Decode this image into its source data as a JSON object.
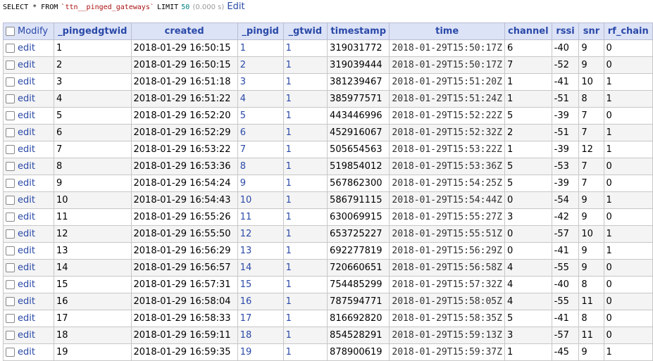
{
  "query": {
    "select": "SELECT * FROM",
    "table": "`ttn__pinged_gateways`",
    "limit": "LIMIT",
    "limit_value": "50",
    "time": "(0.000 s)",
    "edit": "Edit"
  },
  "columns": [
    "_pingedgtwid",
    "created",
    "_pingid",
    "_gtwid",
    "timestamp",
    "time",
    "channel",
    "rssi",
    "snr",
    "rf_chain"
  ],
  "modify_label": "Modify",
  "edit_label": "edit",
  "rows": [
    [
      "1",
      "2018-01-29 16:50:15",
      "1",
      "1",
      "319031772",
      "2018-01-29T15:50:17Z",
      "6",
      "-40",
      "9",
      "0"
    ],
    [
      "2",
      "2018-01-29 16:50:15",
      "2",
      "1",
      "319039444",
      "2018-01-29T15:50:17Z",
      "7",
      "-52",
      "9",
      "0"
    ],
    [
      "3",
      "2018-01-29 16:51:18",
      "3",
      "1",
      "381239467",
      "2018-01-29T15:51:20Z",
      "1",
      "-41",
      "10",
      "1"
    ],
    [
      "4",
      "2018-01-29 16:51:22",
      "4",
      "1",
      "385977571",
      "2018-01-29T15:51:24Z",
      "1",
      "-51",
      "8",
      "1"
    ],
    [
      "5",
      "2018-01-29 16:52:20",
      "5",
      "1",
      "443446996",
      "2018-01-29T15:52:22Z",
      "5",
      "-39",
      "7",
      "0"
    ],
    [
      "6",
      "2018-01-29 16:52:29",
      "6",
      "1",
      "452916067",
      "2018-01-29T15:52:32Z",
      "2",
      "-51",
      "7",
      "1"
    ],
    [
      "7",
      "2018-01-29 16:53:22",
      "7",
      "1",
      "505654563",
      "2018-01-29T15:53:22Z",
      "1",
      "-39",
      "12",
      "1"
    ],
    [
      "8",
      "2018-01-29 16:53:36",
      "8",
      "1",
      "519854012",
      "2018-01-29T15:53:36Z",
      "5",
      "-53",
      "7",
      "0"
    ],
    [
      "9",
      "2018-01-29 16:54:24",
      "9",
      "1",
      "567862300",
      "2018-01-29T15:54:25Z",
      "5",
      "-39",
      "7",
      "0"
    ],
    [
      "10",
      "2018-01-29 16:54:43",
      "10",
      "1",
      "586791115",
      "2018-01-29T15:54:44Z",
      "0",
      "-54",
      "9",
      "1"
    ],
    [
      "11",
      "2018-01-29 16:55:26",
      "11",
      "1",
      "630069915",
      "2018-01-29T15:55:27Z",
      "3",
      "-42",
      "9",
      "0"
    ],
    [
      "12",
      "2018-01-29 16:55:50",
      "12",
      "1",
      "653725227",
      "2018-01-29T15:55:51Z",
      "0",
      "-57",
      "10",
      "1"
    ],
    [
      "13",
      "2018-01-29 16:56:29",
      "13",
      "1",
      "692277819",
      "2018-01-29T15:56:29Z",
      "0",
      "-41",
      "9",
      "1"
    ],
    [
      "14",
      "2018-01-29 16:56:57",
      "14",
      "1",
      "720660651",
      "2018-01-29T15:56:58Z",
      "4",
      "-55",
      "9",
      "0"
    ],
    [
      "15",
      "2018-01-29 16:57:31",
      "15",
      "1",
      "754485299",
      "2018-01-29T15:57:32Z",
      "4",
      "-40",
      "8",
      "0"
    ],
    [
      "16",
      "2018-01-29 16:58:04",
      "16",
      "1",
      "787594771",
      "2018-01-29T15:58:05Z",
      "4",
      "-55",
      "11",
      "0"
    ],
    [
      "17",
      "2018-01-29 16:58:33",
      "17",
      "1",
      "816692820",
      "2018-01-29T15:58:35Z",
      "5",
      "-41",
      "8",
      "0"
    ],
    [
      "18",
      "2018-01-29 16:59:11",
      "18",
      "1",
      "854528291",
      "2018-01-29T15:59:13Z",
      "3",
      "-57",
      "11",
      "0"
    ],
    [
      "19",
      "2018-01-29 16:59:35",
      "19",
      "1",
      "878900619",
      "2018-01-29T15:59:37Z",
      "1",
      "-45",
      "9",
      "1"
    ]
  ]
}
